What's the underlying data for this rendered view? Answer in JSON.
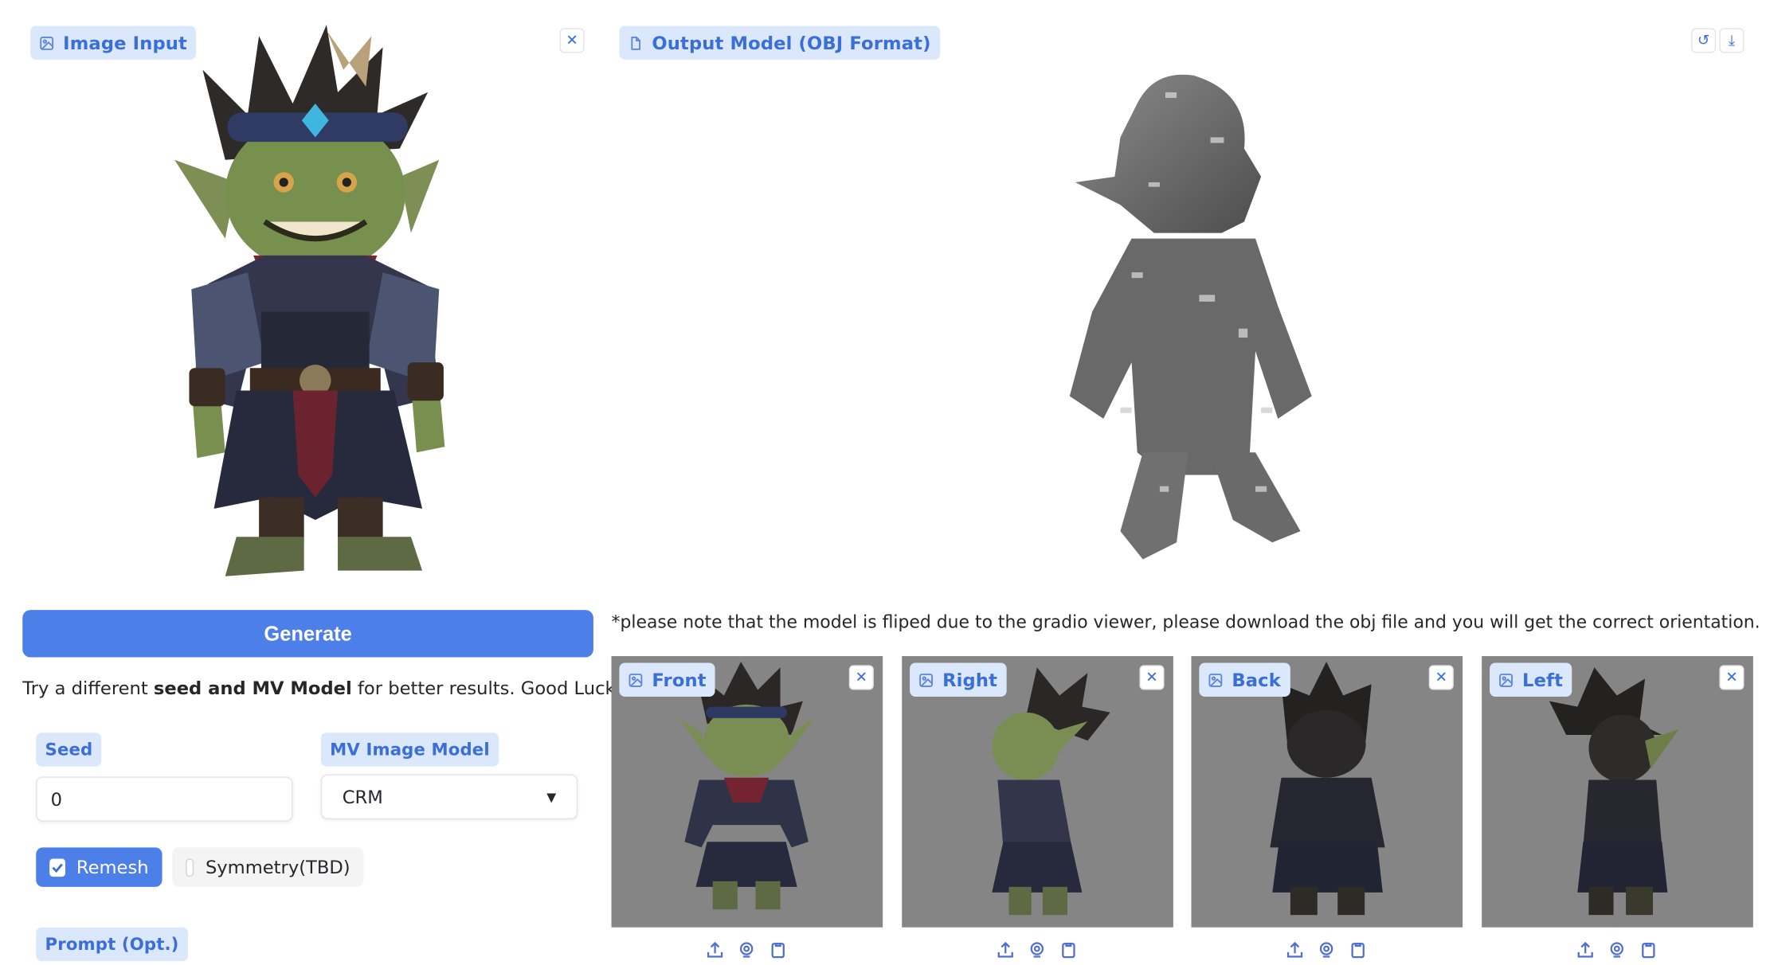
{
  "image_input": {
    "label": "Image Input"
  },
  "output_model": {
    "label": "Output Model (OBJ Format)"
  },
  "generate_button": {
    "label": "Generate"
  },
  "hint": {
    "prefix": "Try a different ",
    "bold": "seed and MV Model",
    "suffix": " for better results. Good Luck :)"
  },
  "seed": {
    "label": "Seed",
    "value": "0"
  },
  "mv_model": {
    "label": "MV Image Model",
    "selected": "CRM"
  },
  "remesh": {
    "label": "Remesh",
    "checked": true
  },
  "symmetry": {
    "label": "Symmetry(TBD)",
    "checked": false
  },
  "prompt": {
    "label": "Prompt (Opt.)"
  },
  "note": "*please note that the model is fliped due to the gradio viewer, please download the obj file and you will get the correct orientation.",
  "views": [
    {
      "label": "Front"
    },
    {
      "label": "Right"
    },
    {
      "label": "Back"
    },
    {
      "label": "Left"
    }
  ],
  "colors": {
    "accent": "#4d7fe9",
    "label_bg": "#dbe7fb",
    "label_text": "#3b6fd8",
    "view_bg": "#858585"
  }
}
